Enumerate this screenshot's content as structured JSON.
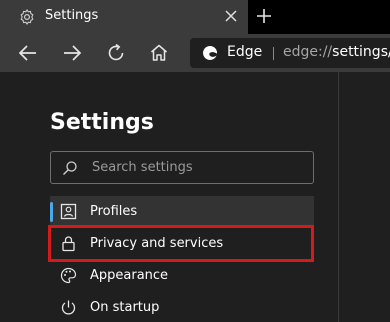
{
  "tab": {
    "title": "Settings",
    "icon": "gear-icon",
    "close_icon": "close-icon"
  },
  "new_tab_icon": "plus-icon",
  "toolbar": {
    "back_icon": "back-arrow-icon",
    "forward_icon": "forward-arrow-icon",
    "refresh_icon": "refresh-icon",
    "home_icon": "home-icon"
  },
  "address": {
    "site_label": "Edge",
    "url_scheme": "edge://",
    "url_path": "settings/",
    "logo_icon": "edge-logo-icon"
  },
  "settings": {
    "title": "Settings",
    "search_placeholder": "Search settings",
    "nav": [
      {
        "label": "Profiles",
        "icon": "profile-icon",
        "active": true
      },
      {
        "label": "Privacy and services",
        "icon": "lock-icon",
        "active": false,
        "highlighted": true
      },
      {
        "label": "Appearance",
        "icon": "palette-icon",
        "active": false
      },
      {
        "label": "On startup",
        "icon": "power-icon",
        "active": false
      }
    ]
  },
  "colors": {
    "accent": "#4ca8e8",
    "highlight": "#d21b1b"
  }
}
